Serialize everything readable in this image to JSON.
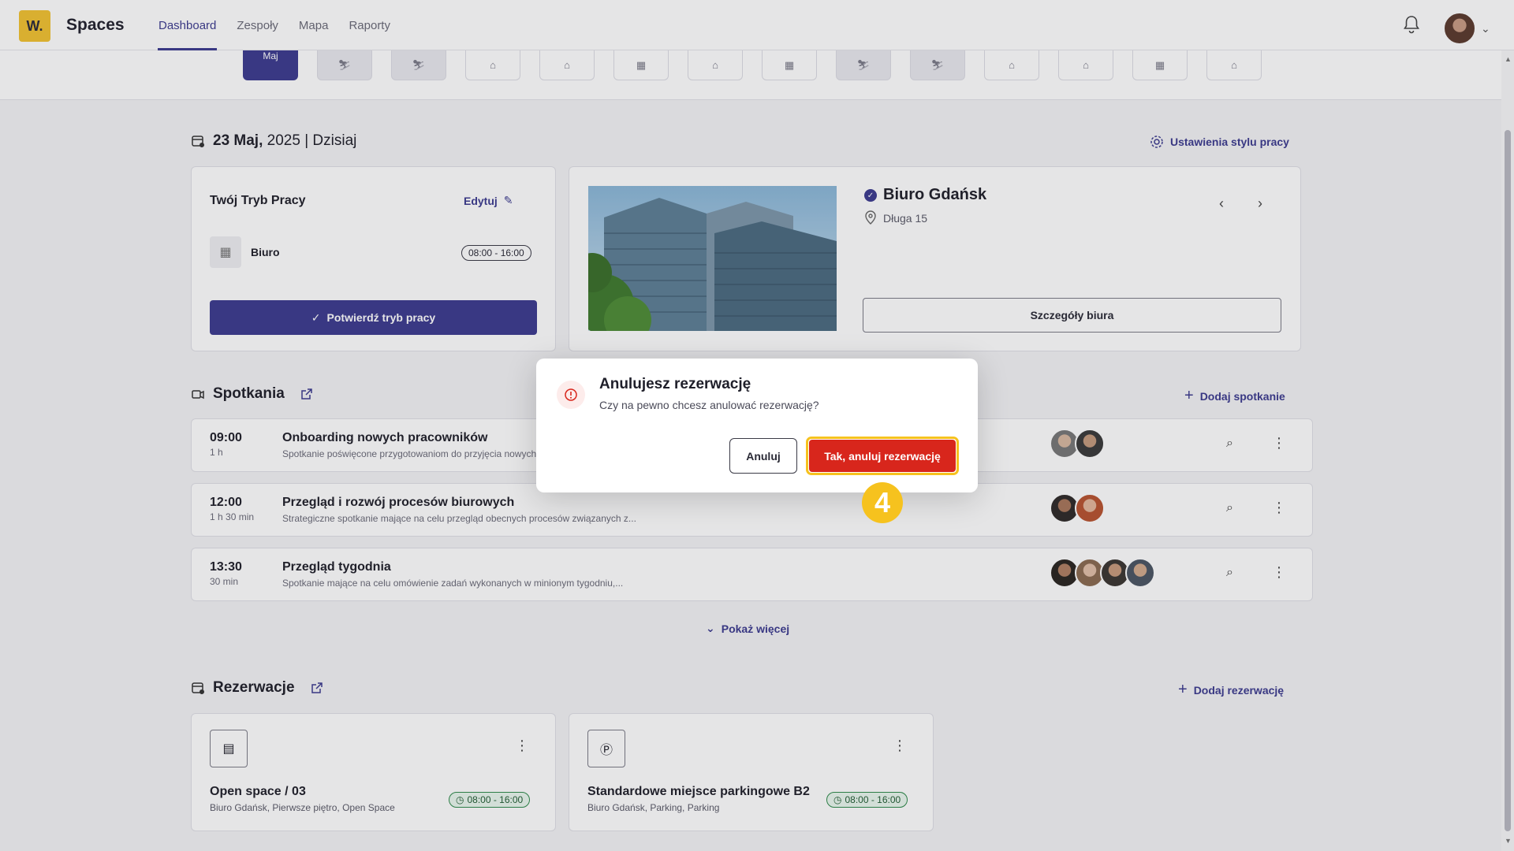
{
  "app": {
    "logo_text": "W.",
    "name": "Spaces"
  },
  "nav": [
    {
      "label": "Dashboard",
      "active": true
    },
    {
      "label": "Zespoły"
    },
    {
      "label": "Mapa"
    },
    {
      "label": "Raporty"
    }
  ],
  "day_strip": {
    "active_label": "Maj"
  },
  "date_header": {
    "day": "23 Maj,",
    "rest": "2025 | Dzisiaj"
  },
  "work_style_settings": "Ustawienia stylu pracy",
  "work_mode": {
    "title": "Twój Tryb Pracy",
    "edit_label": "Edytuj",
    "mode_label": "Biuro",
    "hours": "08:00 - 16:00",
    "confirm_label": "Potwierdź tryb pracy"
  },
  "office": {
    "name": "Biuro Gdańsk",
    "address": "Długa 15",
    "details_label": "Szczegóły biura"
  },
  "meetings": {
    "title": "Spotkania",
    "add_label": "Dodaj spotkanie",
    "show_more": "Pokaż więcej",
    "items": [
      {
        "time": "09:00",
        "duration": "1 h",
        "title": "Onboarding nowych pracowników",
        "desc": "Spotkanie poświęcone przygotowaniom do przyjęcia nowych"
      },
      {
        "time": "12:00",
        "duration": "1 h 30 min",
        "title": "Przegląd i rozwój procesów biurowych",
        "desc": "Strategiczne spotkanie mające na celu przegląd obecnych procesów związanych z..."
      },
      {
        "time": "13:30",
        "duration": "30 min",
        "title": "Przegląd tygodnia",
        "desc": "Spotkanie mające na celu omówienie zadań wykonanych w minionym tygodniu,..."
      }
    ]
  },
  "reservations": {
    "title": "Rezerwacje",
    "add_label": "Dodaj rezerwację",
    "items": [
      {
        "title": "Open space / 03",
        "subtitle": "Biuro Gdańsk, Pierwsze piętro, Open Space",
        "hours": "08:00 - 16:00"
      },
      {
        "title": "Standardowe miejsce parkingowe B2",
        "subtitle": "Biuro Gdańsk, Parking, Parking",
        "hours": "08:00 - 16:00"
      }
    ]
  },
  "modal": {
    "title": "Anulujesz rezerwację",
    "text": "Czy na pewno chcesz anulować rezerwację?",
    "cancel_label": "Anuluj",
    "confirm_label": "Tak, anuluj rezerwację"
  },
  "step_badge": "4",
  "colors": {
    "brand": "#3c3b8f",
    "danger": "#d8261c",
    "highlight": "#f6c21e",
    "logo": "#f2c230"
  }
}
